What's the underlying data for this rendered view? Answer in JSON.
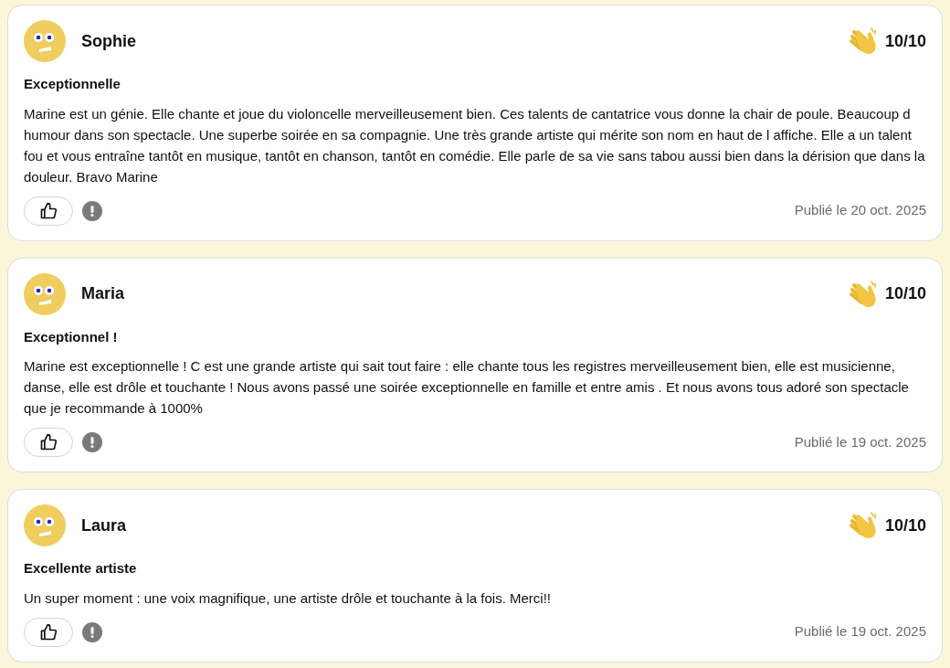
{
  "reviews": [
    {
      "author": "Sophie",
      "score": "10/10",
      "title": "Exceptionnelle",
      "text": "Marine est un génie. Elle chante et joue du violoncelle merveilleusement bien. Ces talents de cantatrice vous donne la chair de poule. Beaucoup d humour dans son spectacle. Une superbe soirée en sa compagnie. Une très grande artiste qui mérite son nom en haut de l affiche. Elle a un talent fou et vous entraîne tantôt en musique, tantôt en chanson, tantôt en comédie. Elle parle de sa vie sans tabou aussi bien dans la dérision que dans la douleur. Bravo Marine",
      "date": "Publié le 20 oct. 2025"
    },
    {
      "author": "Maria",
      "score": "10/10",
      "title": "Exceptionnel !",
      "text": "Marine est exceptionnelle ! C est une grande artiste qui sait tout faire : elle chante tous les registres merveilleusement bien, elle est musicienne, danse, elle est drôle et touchante ! Nous avons passé une soirée exceptionnelle en famille et entre amis . Et nous avons tous adoré son spectacle que je recommande à 1000%",
      "date": "Publié le 19 oct. 2025"
    },
    {
      "author": "Laura",
      "score": "10/10",
      "title": "Excellente artiste",
      "text": "Un super moment : une voix magnifique, une artiste drôle et touchante à la fois. Merci!!",
      "date": "Publié le 19 oct. 2025"
    }
  ]
}
